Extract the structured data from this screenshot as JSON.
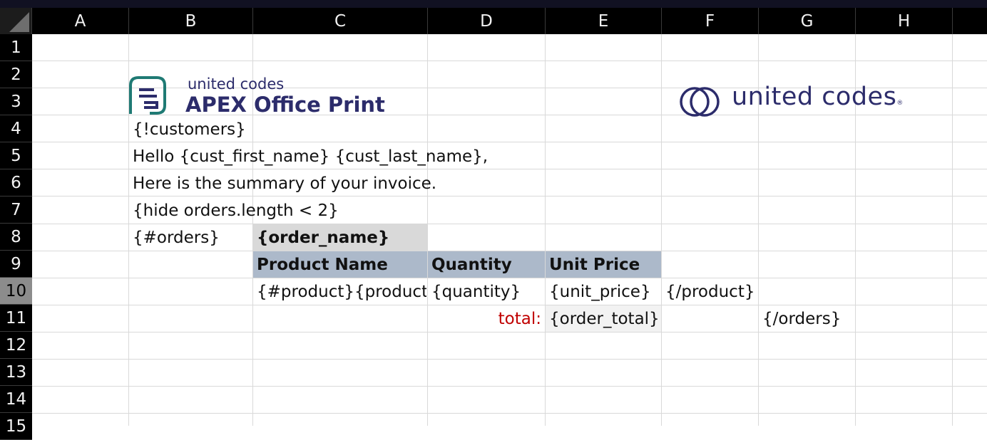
{
  "columns": [
    "A",
    "B",
    "C",
    "D",
    "E",
    "F",
    "G",
    "H"
  ],
  "rows": [
    "1",
    "2",
    "3",
    "4",
    "5",
    "6",
    "7",
    "8",
    "9",
    "10",
    "11",
    "12",
    "13",
    "14",
    "15"
  ],
  "selected_row": "10",
  "logos": {
    "aop_small": "united codes",
    "aop_big": "APEX Office Print",
    "uc_text": "united codes",
    "uc_mark": "®"
  },
  "cells": {
    "B4": "{!customers}",
    "B5": "Hello {cust_first_name} {cust_last_name},",
    "B6": "Here is the summary of your invoice.",
    "B7": "{hide orders.length < 2}",
    "B8": "{#orders}",
    "C8": "{order_name}",
    "C9": "Product Name",
    "D9": "Quantity",
    "E9": "Unit Price",
    "C10": "{#product}{product_name}",
    "D10": "{quantity}",
    "E10": "{unit_price}",
    "F10": "{/product}",
    "D11": "total:",
    "E11": "{order_total}",
    "G11": "{/orders}"
  },
  "colors": {
    "header_fill": "#acb9ca",
    "order_name_fill": "#d9d9d9",
    "order_total_fill": "#f2f2f2",
    "total_label": "#c00000",
    "brand": "#2c2c6b",
    "aop_icon": "#1f7a74"
  }
}
